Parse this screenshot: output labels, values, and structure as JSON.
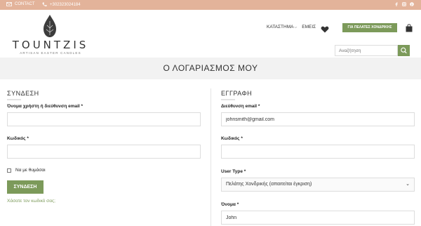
{
  "topbar": {
    "contact_label": "CONTACT",
    "phone": "+302323024184",
    "social_icons": [
      "facebook-icon",
      "instagram-icon",
      "pinterest-icon"
    ]
  },
  "brand": {
    "name": "TOUNTZIS",
    "tagline": "ARTISAN EASTER CANDLES"
  },
  "nav": {
    "items": [
      {
        "label": "ΚΑΤΑΣΤΗΜΑ",
        "has_dropdown": true
      },
      {
        "label": "ΕΜΕΙΣ",
        "has_dropdown": false
      }
    ],
    "wholesale_button": "ΓΙΑ ΠΕΛΑΤΕΣ ΧΟΝΔΡΙΚΗΣ"
  },
  "search": {
    "placeholder": "Αναζήτηση"
  },
  "page": {
    "title": "Ο ΛΟΓΑΡΙΑΣΜΟΣ ΜΟΥ"
  },
  "login": {
    "heading": "ΣΥΝΔΕΣΗ",
    "username_label": "Όνομα χρήστη ή διεύθυνση email *",
    "username_value": "",
    "password_label": "Κωδικός *",
    "password_value": "",
    "remember_label": "Να με θυμάσαι",
    "submit_label": "ΣΥΝΔΕΣΗ",
    "lost_password": "Χάσατε τον κωδικό σας;"
  },
  "register": {
    "heading": "ΕΓΓΡΑΦΗ",
    "email_label": "Διεύθυνση email *",
    "email_value": "johnsmith@gmail.com",
    "password_label": "Κωδικός *",
    "password_value": "",
    "usertype_label": "User Type *",
    "usertype_value": "Πελάτης Χονδρικής (απαιτείται έγκριση)",
    "name_label": "Όνομα *",
    "name_value": "John"
  },
  "colors": {
    "topbar": "#e3b39a",
    "accent_green": "#7c9a5a",
    "title_band": "#f2f2f2"
  }
}
